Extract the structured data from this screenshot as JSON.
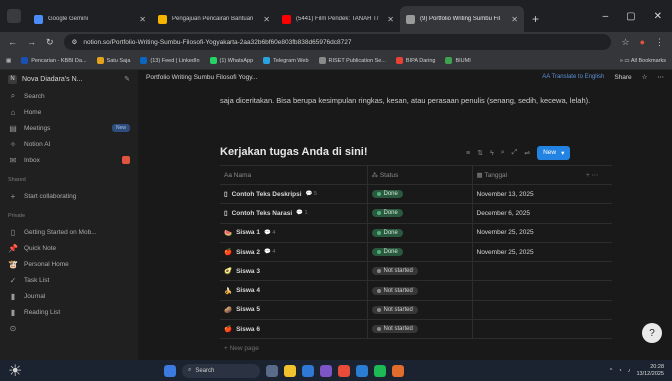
{
  "browser": {
    "tabs": [
      {
        "label": "Google Gemini",
        "color": "#4b8df8",
        "active": false
      },
      {
        "label": "Pengajuan Pencairan Bantuan",
        "color": "#f4b400",
        "active": false
      },
      {
        "label": "(5441) Film Pendek: TANAH T/",
        "color": "#ff0000",
        "active": false
      },
      {
        "label": "(9) Portfolio Writing Sumbu Fil",
        "color": "#9a9a9a",
        "active": true
      }
    ],
    "url": "notion.so/Portfolio-Writing-Sumbu-Filosofi-Yogyakarta-2aa32b6bf60e803fb838d65976dc8727",
    "bookmarks": [
      {
        "label": "Pencarian - KBBI Da...",
        "color": "#1a4fb4"
      },
      {
        "label": "Satu Saja",
        "color": "#e3a21a"
      },
      {
        "label": "(13) Feed | LinkedIn",
        "color": "#0a66c2"
      },
      {
        "label": "(1) WhatsApp",
        "color": "#25d366"
      },
      {
        "label": "Telegram Web",
        "color": "#2aa3e0"
      },
      {
        "label": "RISET Publication Se...",
        "color": "#8a8a8a"
      },
      {
        "label": "BIPA Daring",
        "color": "#e94235"
      },
      {
        "label": "BIUMI",
        "color": "#3fa34d"
      }
    ],
    "all_bookmarks": "All Bookmarks"
  },
  "sidebar": {
    "workspace": "Nova Diadara's N...",
    "workspace_initial": "N",
    "items": [
      {
        "label": "Search",
        "icon": "⌕"
      },
      {
        "label": "Home",
        "icon": "⌂"
      },
      {
        "label": "Meetings",
        "icon": "▤",
        "badge": "New"
      },
      {
        "label": "Notion AI",
        "icon": "✧"
      },
      {
        "label": "Inbox",
        "icon": "✉"
      }
    ],
    "shared_label": "Shared",
    "start_collab": "Start collaborating",
    "private_label": "Private",
    "private_items": [
      {
        "label": "Getting Started on Mob...",
        "icon": "▯"
      },
      {
        "label": "Quick Note",
        "icon": "📌"
      },
      {
        "label": "Personal Home",
        "icon": "🐮"
      },
      {
        "label": "Task List",
        "icon": "✓"
      },
      {
        "label": "Journal",
        "icon": "▮"
      },
      {
        "label": "Reading List",
        "icon": "▮"
      }
    ]
  },
  "page": {
    "breadcrumb": "Portfolio Writing Sumbu Filosofi Yogy...",
    "translate": "AA Translate to English",
    "share": "Share",
    "paragraph": "saja diceritakan. Bisa berupa kesimpulan ringkas, kesan, atau perasaan penulis (senang, sedih, kecewa, lelah).",
    "db_title": "Kerjakan tugas Anda di sini!",
    "new_button": "New",
    "columns": {
      "name": "Aa Nama",
      "status": "Status",
      "date": "Tanggal"
    },
    "rows": [
      {
        "name": "Contoh Teks Deskripsi",
        "icon": "▯",
        "comments": "5",
        "status": "Done",
        "date": "November 13, 2025"
      },
      {
        "name": "Contoh Teks Narasi",
        "icon": "▯",
        "comments": "1",
        "status": "Done",
        "date": "December 6, 2025"
      },
      {
        "name": "Siswa 1",
        "icon": "🍉",
        "comments": "4",
        "status": "Done",
        "date": "November 25, 2025"
      },
      {
        "name": "Siswa 2",
        "icon": "🍎",
        "comments": "4",
        "status": "Done",
        "date": "November 25, 2025"
      },
      {
        "name": "Siswa 3",
        "icon": "🥑",
        "comments": "",
        "status": "Not started",
        "date": ""
      },
      {
        "name": "Siswa 4",
        "icon": "🍌",
        "comments": "",
        "status": "Not started",
        "date": ""
      },
      {
        "name": "Siswa 5",
        "icon": "🥔",
        "comments": "",
        "status": "Not started",
        "date": ""
      },
      {
        "name": "Siswa 6",
        "icon": "🍎",
        "comments": "",
        "status": "Not started",
        "date": ""
      }
    ],
    "new_page": "+ New page"
  },
  "taskbar": {
    "search": "Search",
    "time": "20:28",
    "date": "13/12/2025"
  }
}
